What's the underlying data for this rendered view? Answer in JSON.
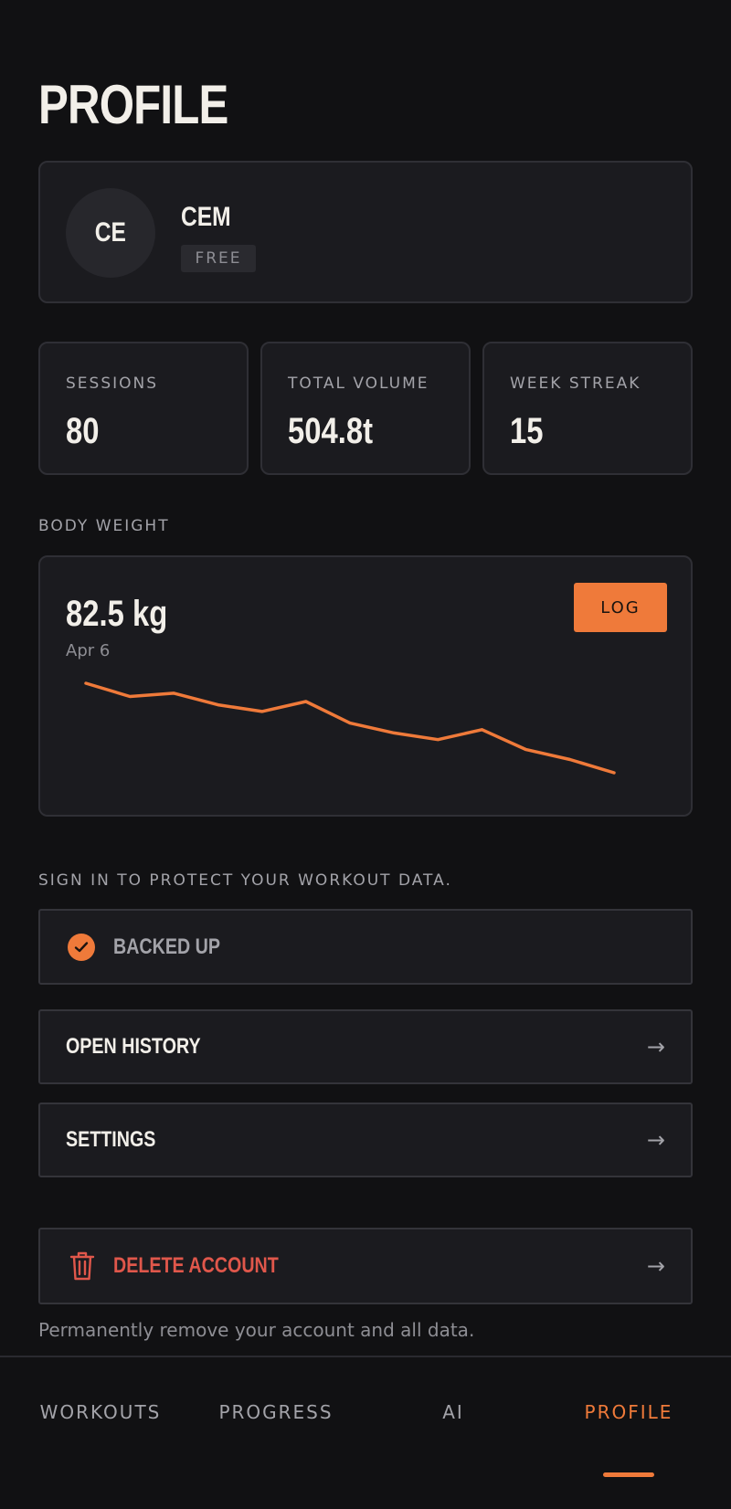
{
  "header": {
    "title": "PROFILE"
  },
  "user": {
    "initials": "CE",
    "name": "CEM",
    "plan": "FREE"
  },
  "stats": [
    {
      "label": "SESSIONS",
      "value": "80"
    },
    {
      "label": "TOTAL VOLUME",
      "value": "504.8t"
    },
    {
      "label": "WEEK STREAK",
      "value": "15"
    }
  ],
  "body_weight": {
    "section_label": "BODY WEIGHT",
    "current_value": "82.5 kg",
    "date": "Apr 6",
    "log_label": "LOG",
    "trend": [
      86.6,
      85.8,
      86.0,
      85.3,
      84.9,
      85.5,
      84.2,
      83.6,
      83.2,
      83.8,
      82.6,
      82.0,
      81.2
    ],
    "line_color": "#ef7a3a"
  },
  "account": {
    "prompt": "SIGN IN TO PROTECT YOUR WORKOUT DATA.",
    "backed_up_label": "BACKED UP",
    "open_history_label": "OPEN HISTORY",
    "settings_label": "SETTINGS",
    "delete_label": "DELETE ACCOUNT",
    "delete_helper": "Permanently remove your account and all data.",
    "arrow": "→",
    "danger_color": "#e0574b"
  },
  "tabs": [
    {
      "label": "WORKOUTS",
      "active": false
    },
    {
      "label": "PROGRESS",
      "active": false
    },
    {
      "label": "AI",
      "active": false
    },
    {
      "label": "PROFILE",
      "active": true
    }
  ],
  "colors": {
    "accent": "#ef7a3a",
    "background": "#111113",
    "card": "#1b1b1f"
  }
}
